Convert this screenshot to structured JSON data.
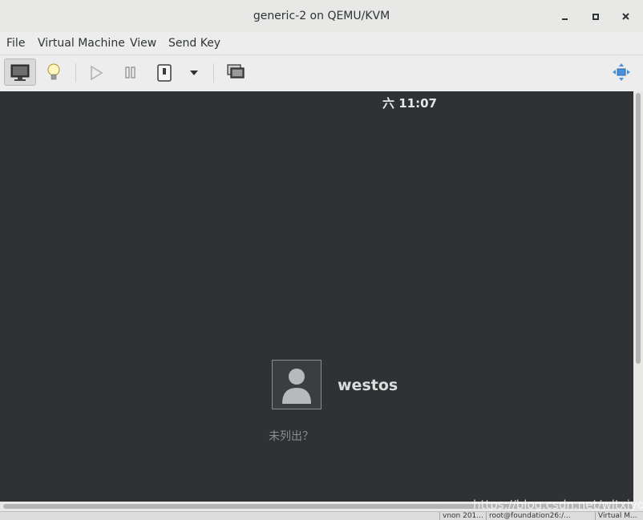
{
  "window": {
    "title": "generic-2 on QEMU/KVM"
  },
  "menubar": {
    "items": [
      "File",
      "Virtual Machine",
      "View",
      "Send Key"
    ]
  },
  "toolbar": {
    "buttons": [
      {
        "icon": "monitor-icon",
        "active": true
      },
      {
        "icon": "lightbulb-icon"
      },
      {
        "icon": "play-icon"
      },
      {
        "icon": "pause-icon"
      },
      {
        "icon": "power-icon"
      },
      {
        "icon": "dropdown-arrow-icon"
      },
      {
        "icon": "snapshots-icon"
      },
      {
        "icon": "fullscreen-icon"
      }
    ]
  },
  "vm_screen": {
    "clock": "六 11:07",
    "user_name": "westos",
    "not_listed": "未列出？",
    "background": "#2f3234"
  },
  "taskbar": {
    "items": [
      "vnon 201...",
      "root@foundation26:/...",
      "Virtual M..."
    ]
  },
  "watermark": "https://blog.csdn.net/wltxiyou"
}
